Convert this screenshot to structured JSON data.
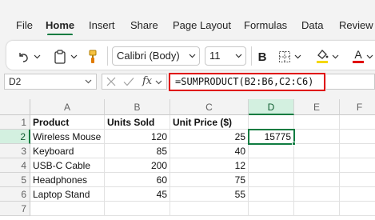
{
  "menu": {
    "tabs": [
      "File",
      "Home",
      "Insert",
      "Share",
      "Page Layout",
      "Formulas",
      "Data",
      "Review"
    ],
    "active_tab": "Home"
  },
  "ribbon": {
    "font_name": "Calibri (Body)",
    "font_size": "11",
    "bold_label": "B",
    "font_color_label": "A"
  },
  "formula_bar": {
    "name_box": "D2",
    "fx_label": "fx",
    "formula": "=SUMPRODUCT(B2:B6,C2:C6)"
  },
  "sheet": {
    "columns": [
      "A",
      "B",
      "C",
      "D",
      "E",
      "F"
    ],
    "selected_column": "D",
    "row_numbers": [
      "1",
      "2",
      "3",
      "4",
      "5",
      "6",
      "7"
    ],
    "selected_row": "2",
    "headers": [
      "Product",
      "Units Sold",
      "Unit Price ($)"
    ],
    "rows": [
      {
        "product": "Wireless Mouse",
        "units": "120",
        "price": "25"
      },
      {
        "product": "Keyboard",
        "units": "85",
        "price": "40"
      },
      {
        "product": "USB-C Cable",
        "units": "200",
        "price": "12"
      },
      {
        "product": "Headphones",
        "units": "60",
        "price": "75"
      },
      {
        "product": "Laptop Stand",
        "units": "45",
        "price": "55"
      }
    ],
    "result": "15775"
  },
  "colors": {
    "accent": "#107c41",
    "highlight_border": "#e00000"
  }
}
